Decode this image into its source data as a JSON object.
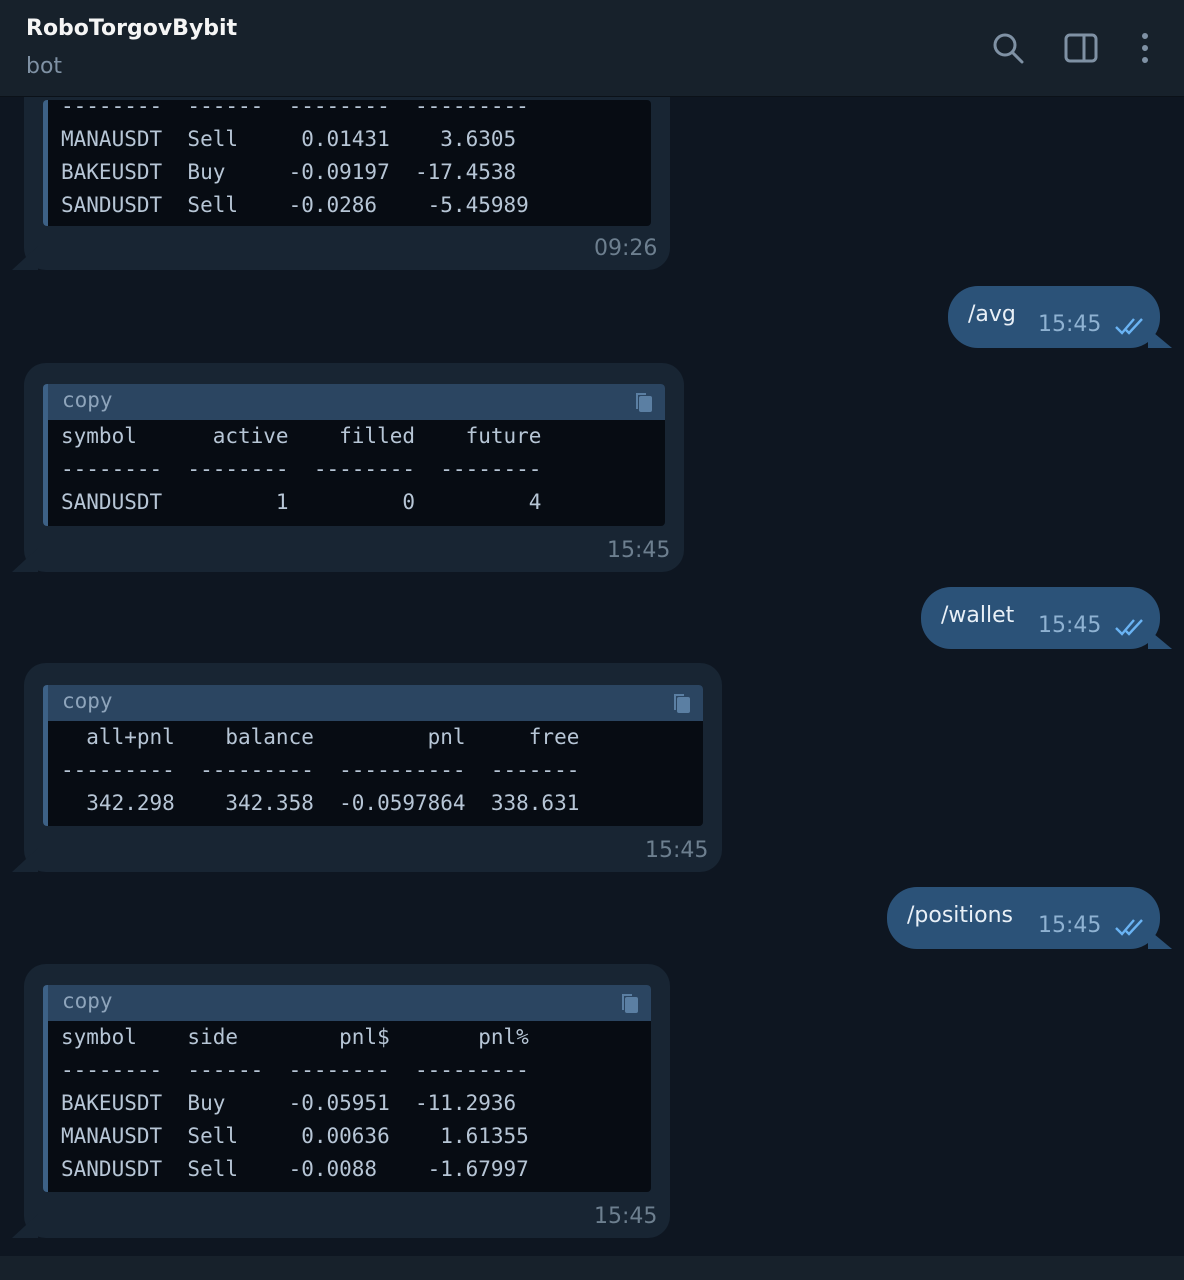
{
  "header": {
    "title": "RoboTorgovBybit",
    "subtitle": "bot",
    "icons": [
      "search-icon",
      "sidebar-toggle-icon",
      "more-vertical-icon"
    ]
  },
  "messages": [
    {
      "direction": "in",
      "code": {
        "lines": [
          "--------  ------  --------  ---------",
          "MANAUSDT  Sell     0.01431    3.6305",
          "BAKEUSDT  Buy     -0.09197  -17.4538",
          "SANDUSDT  Sell    -0.0286    -5.45989"
        ]
      },
      "time": "09:26"
    },
    {
      "direction": "out",
      "text": "/avg",
      "time": "15:45"
    },
    {
      "direction": "in",
      "code": {
        "lang": "copy",
        "lines": [
          "symbol      active    filled    future",
          "--------  --------  --------  --------",
          "SANDUSDT         1         0         4"
        ]
      },
      "time": "15:45"
    },
    {
      "direction": "out",
      "text": "/wallet",
      "time": "15:45"
    },
    {
      "direction": "in",
      "code": {
        "lang": "copy",
        "lines": [
          "  all+pnl    balance         pnl     free",
          "---------  ---------  ----------  -------",
          "  342.298    342.358  -0.0597864  338.631"
        ]
      },
      "time": "15:45"
    },
    {
      "direction": "out",
      "text": "/positions",
      "time": "15:45"
    },
    {
      "direction": "in",
      "code": {
        "lang": "copy",
        "lines": [
          "symbol    side        pnl$       pnl%",
          "--------  ------  --------  ---------",
          "BAKEUSDT  Buy     -0.05951  -11.2936",
          "MANAUSDT  Sell     0.00636    1.61355",
          "SANDUSDT  Sell    -0.0088    -1.67997"
        ]
      },
      "time": "15:45"
    }
  ],
  "colors": {
    "background": "#0e1621",
    "incoming_bubble": "#182533",
    "outgoing_bubble": "#2b5278",
    "code_header": "#2b4561",
    "code_background": "#070c13"
  }
}
